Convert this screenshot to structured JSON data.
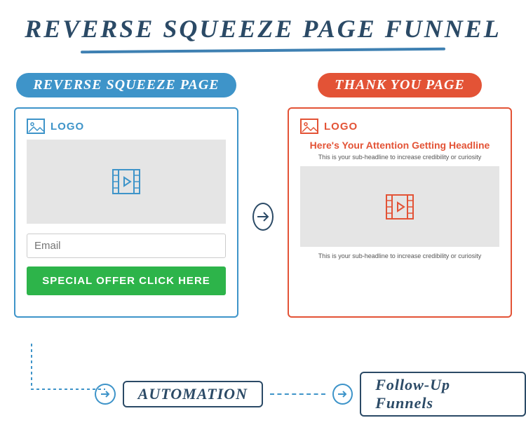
{
  "title": "REVERSE SQUEEZE PAGE FUNNEL",
  "pages": {
    "squeeze": {
      "pill": "REVERSE SQUEEZE PAGE",
      "logo": "LOGO",
      "emailPlaceholder": "Email",
      "cta": "SPECIAL OFFER CLICK HERE"
    },
    "thankyou": {
      "pill": "THANK YOU PAGE",
      "logo": "LOGO",
      "headline": "Here's Your Attention Getting Headline",
      "subhead1": "This is your sub-headline to increase credibility or curiosity",
      "subhead2": "This is your sub-headline to increase credibility or curiosity"
    }
  },
  "bottom": {
    "automation": "AUTOMATION",
    "followup": "Follow-Up Funnels"
  },
  "colors": {
    "navy": "#2b4a66",
    "blue": "#3e94c9",
    "red": "#e35336",
    "green": "#2db44a",
    "gray": "#e5e5e5"
  }
}
